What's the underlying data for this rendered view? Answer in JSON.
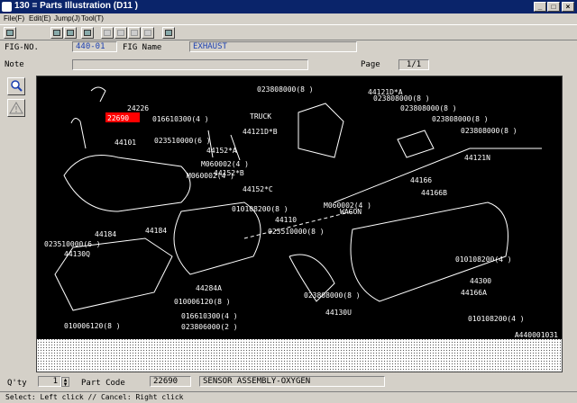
{
  "window": {
    "title": "130 = Parts Illustration (D11   )"
  },
  "menu": [
    "File(F)",
    "Edit(E)",
    "Jump(J)",
    "Tool(T)"
  ],
  "header": {
    "fig_no_label": "FIG-NO.",
    "fig_no_value": "440-01",
    "fig_name_label": "FIG Name",
    "fig_name_value": "EXHAUST",
    "note_label": "Note",
    "note_value": "",
    "page_label": "Page",
    "page_value": "1/1"
  },
  "diagram": {
    "code": "A440001031",
    "labels": [
      "24226",
      "22690",
      "016610300(4 )",
      "44101",
      "TRUCK",
      "44121D*B",
      "023510000(6 )",
      "023808000(8 )",
      "44121D*A",
      "023808000(8 )",
      "023808000(8 )",
      "023808000(8 )",
      "023808000(8 )",
      "44152*A",
      "M060002(4 )",
      "44152*B",
      "M060002(4 )",
      "44152*C",
      "M060002(4 )",
      "010108200(8 )",
      "44110",
      "WAGON",
      "023510000(8 )",
      "44166",
      "44166B",
      "44121N",
      "44184",
      "44184",
      "023510000(6 )",
      "44130Q",
      "44284A",
      "010006120(8 )",
      "016610300(4 )",
      "023806000(2 )",
      "023808000(8 )",
      "44130U",
      "010108200(4 )",
      "44300",
      "44166A",
      "010108200(4 )",
      "010006120(8 )"
    ]
  },
  "footer": {
    "qty_label": "Q'ty",
    "qty_value": "1",
    "part_code_label": "Part Code",
    "part_code_value": "22690",
    "part_name_value": "SENSOR ASSEMBLY-OXYGEN"
  },
  "status": {
    "text": "Select: Left click // Cancel: Right click"
  },
  "icons": {
    "zoom": "zoom-icon",
    "warning": "warning-icon"
  },
  "colors": {
    "highlight": "#ff0000",
    "title_bar": "#0a246a",
    "field_blue": "#1b3fb0"
  }
}
